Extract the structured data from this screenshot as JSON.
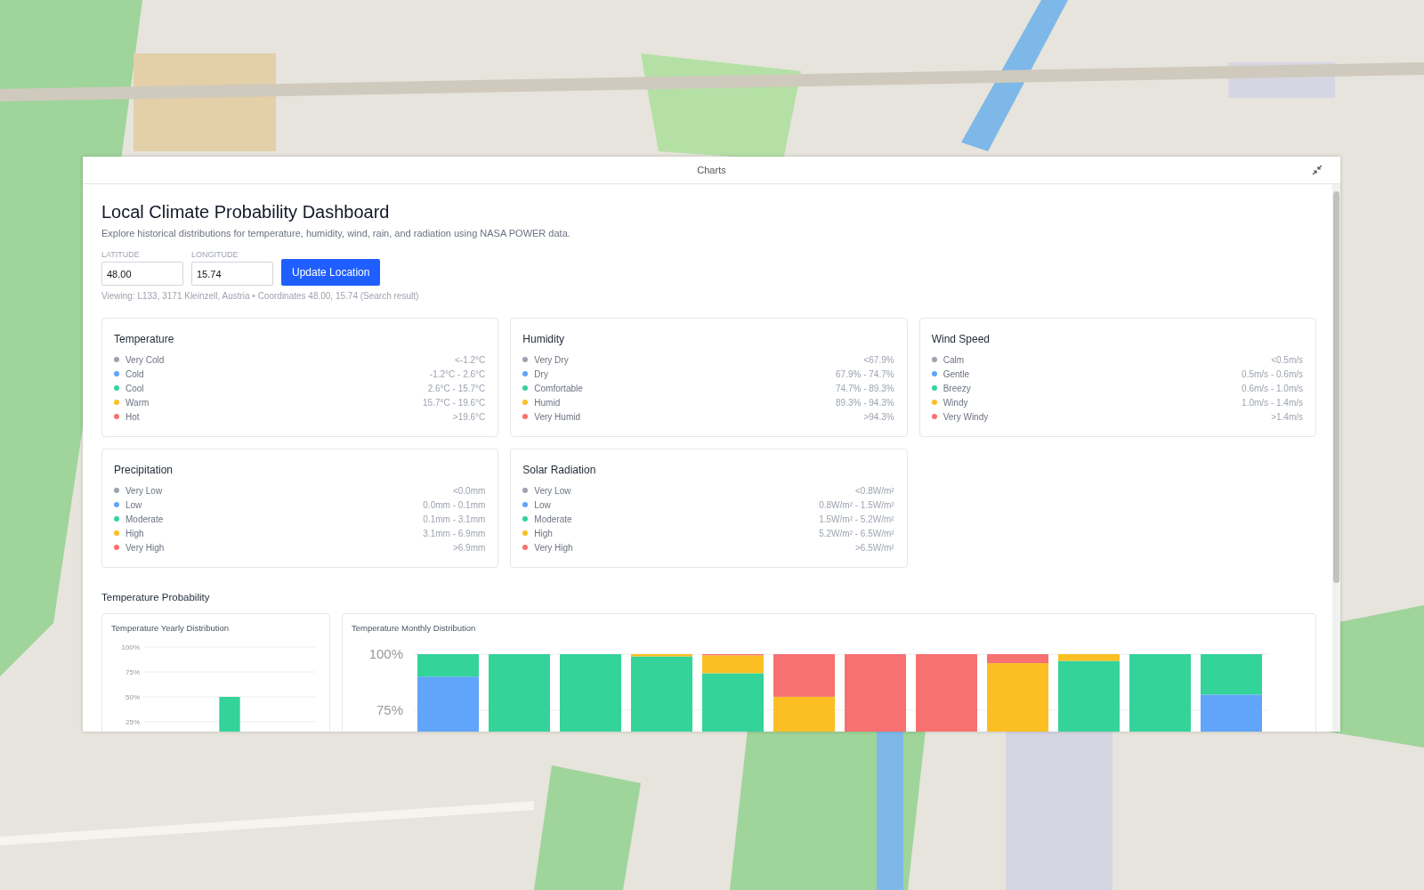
{
  "dialog": {
    "title": "Charts"
  },
  "header": {
    "title": "Local Climate Probability Dashboard",
    "subtitle": "Explore historical distributions for temperature, humidity, wind, rain, and radiation using NASA POWER data."
  },
  "location": {
    "latitude_label": "LATITUDE",
    "latitude": "48.00",
    "longitude_label": "LONGITUDE",
    "longitude": "15.74",
    "button": "Update Location",
    "viewing": "Viewing: L133, 3171 Kleinzell, Austria • Coordinates 48.00, 15.74 (Search result)"
  },
  "cards": [
    {
      "title": "Temperature",
      "rows": [
        {
          "label": "Very Cold",
          "range": "<-1.2°C",
          "color": "#9ca3af"
        },
        {
          "label": "Cold",
          "range": "-1.2°C - 2.6°C",
          "color": "#60a5fa"
        },
        {
          "label": "Cool",
          "range": "2.6°C - 15.7°C",
          "color": "#34d399"
        },
        {
          "label": "Warm",
          "range": "15.7°C - 19.6°C",
          "color": "#fbbf24"
        },
        {
          "label": "Hot",
          "range": ">19.6°C",
          "color": "#f87171"
        }
      ]
    },
    {
      "title": "Humidity",
      "rows": [
        {
          "label": "Very Dry",
          "range": "<67.9%",
          "color": "#9ca3af"
        },
        {
          "label": "Dry",
          "range": "67.9% - 74.7%",
          "color": "#60a5fa"
        },
        {
          "label": "Comfortable",
          "range": "74.7% - 89.3%",
          "color": "#34d399"
        },
        {
          "label": "Humid",
          "range": "89.3% - 94.3%",
          "color": "#fbbf24"
        },
        {
          "label": "Very Humid",
          "range": ">94.3%",
          "color": "#f87171"
        }
      ]
    },
    {
      "title": "Wind Speed",
      "rows": [
        {
          "label": "Calm",
          "range": "<0.5m/s",
          "color": "#9ca3af"
        },
        {
          "label": "Gentle",
          "range": "0.5m/s - 0.6m/s",
          "color": "#60a5fa"
        },
        {
          "label": "Breezy",
          "range": "0.6m/s - 1.0m/s",
          "color": "#34d399"
        },
        {
          "label": "Windy",
          "range": "1.0m/s - 1.4m/s",
          "color": "#fbbf24"
        },
        {
          "label": "Very Windy",
          "range": ">1.4m/s",
          "color": "#f87171"
        }
      ]
    },
    {
      "title": "Precipitation",
      "rows": [
        {
          "label": "Very Low",
          "range": "<0.0mm",
          "color": "#9ca3af"
        },
        {
          "label": "Low",
          "range": "0.0mm - 0.1mm",
          "color": "#60a5fa"
        },
        {
          "label": "Moderate",
          "range": "0.1mm - 3.1mm",
          "color": "#34d399"
        },
        {
          "label": "High",
          "range": "3.1mm - 6.9mm",
          "color": "#fbbf24"
        },
        {
          "label": "Very High",
          "range": ">6.9mm",
          "color": "#f87171"
        }
      ]
    },
    {
      "title": "Solar Radiation",
      "rows": [
        {
          "label": "Very Low",
          "range": "<0.8W/m²",
          "color": "#9ca3af"
        },
        {
          "label": "Low",
          "range": "0.8W/m² - 1.5W/m²",
          "color": "#60a5fa"
        },
        {
          "label": "Moderate",
          "range": "1.5W/m² - 5.2W/m²",
          "color": "#34d399"
        },
        {
          "label": "High",
          "range": "5.2W/m² - 6.5W/m²",
          "color": "#fbbf24"
        },
        {
          "label": "Very High",
          "range": ">6.5W/m²",
          "color": "#f87171"
        }
      ]
    }
  ],
  "section": {
    "title": "Temperature Probability"
  },
  "yearly": {
    "title": "Temperature Yearly Distribution",
    "chart_data": {
      "type": "bar",
      "grid": true,
      "ylim": [
        0,
        100
      ],
      "yticks": [
        {
          "value": 100,
          "label": "100%"
        },
        {
          "value": 75,
          "label": "75%"
        },
        {
          "value": 50,
          "label": "50%"
        },
        {
          "value": 25,
          "label": "25%"
        }
      ],
      "series": [
        {
          "color": "#34d399",
          "values": [
            null,
            null,
            50,
            null,
            null
          ]
        }
      ]
    }
  },
  "monthly": {
    "title": "Temperature Monthly Distribution",
    "chart_data": {
      "type": "bar",
      "stacked": true,
      "grid": true,
      "ylim": [
        0,
        100
      ],
      "yticks": [
        {
          "value": 100,
          "label": "100%"
        },
        {
          "value": 75,
          "label": "75%"
        }
      ],
      "series": [
        {
          "color": "#60a5fa",
          "values": [
            90,
            0,
            0,
            0,
            0,
            0,
            0,
            0,
            0,
            0,
            0,
            82
          ]
        },
        {
          "color": "#34d399",
          "values": [
            10,
            100,
            100,
            99,
            91.5,
            0,
            0,
            0,
            0,
            97,
            100,
            18
          ]
        },
        {
          "color": "#fbbf24",
          "values": [
            0,
            0,
            0,
            1,
            8,
            81,
            0,
            0,
            96,
            3,
            0,
            0
          ]
        },
        {
          "color": "#f87171",
          "values": [
            0,
            0,
            0,
            0,
            0.5,
            19,
            100,
            100,
            4,
            0,
            0,
            0
          ]
        }
      ]
    }
  }
}
